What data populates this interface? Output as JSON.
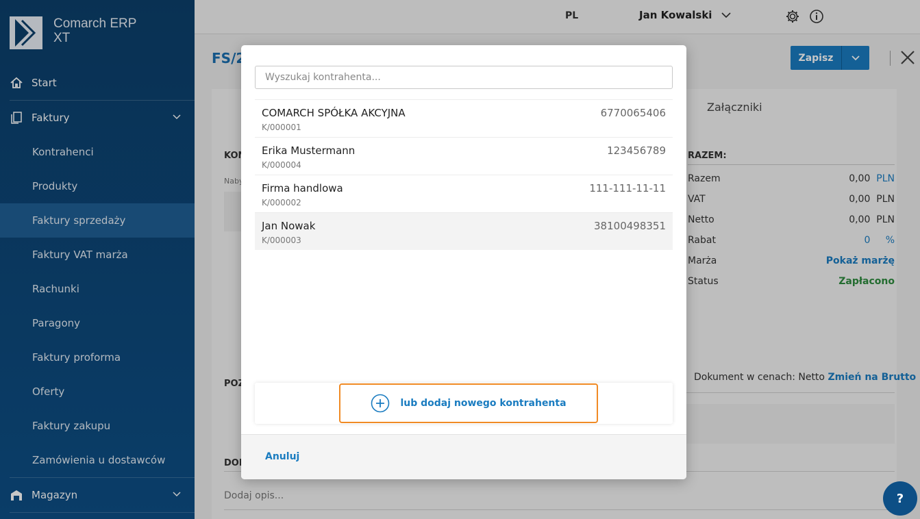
{
  "app": {
    "name_line1": "Comarch ERP",
    "name_line2": "XT"
  },
  "sidebar": {
    "items": [
      {
        "label": "Start",
        "icon": "home-icon"
      },
      {
        "label": "Faktury",
        "icon": "documents-icon"
      },
      {
        "label": "Kontrahenci"
      },
      {
        "label": "Produkty"
      },
      {
        "label": "Faktury sprzedaży"
      },
      {
        "label": "Faktury VAT marża"
      },
      {
        "label": "Rachunki"
      },
      {
        "label": "Paragony"
      },
      {
        "label": "Faktury proforma"
      },
      {
        "label": "Oferty"
      },
      {
        "label": "Faktury zakupu"
      },
      {
        "label": "Zamówienia u dostawców"
      },
      {
        "label": "Magazyn",
        "icon": "warehouse-icon"
      }
    ],
    "active_index": 4
  },
  "topbar": {
    "language": "PL",
    "user": "Jan Kowalski"
  },
  "page": {
    "title": "FS/2",
    "save_label": "Zapisz"
  },
  "background": {
    "tab_attachments": "Załączniki",
    "label_kon": "KON",
    "label_naby": "Naby",
    "label_poz": "POZ",
    "label_dod": "DOD",
    "summary_title": "RAZEM:",
    "summary": [
      {
        "label": "Razem",
        "value": "0,00",
        "currency": "PLN"
      },
      {
        "label": "VAT",
        "value": "0,00",
        "currency": "PLN"
      },
      {
        "label": "Netto",
        "value": "0,00",
        "currency": "PLN"
      },
      {
        "label": "Rabat",
        "value": "0",
        "currency": "%"
      },
      {
        "label": "Marża",
        "value": "Pokaż marżę"
      },
      {
        "label": "Status",
        "value": "Zapłacono"
      }
    ],
    "doc_prices_text": "Dokument w cenach: Netto",
    "doc_prices_link": "Zmień na Brutto",
    "description_placeholder": "Dodaj opis...",
    "help_label": "?"
  },
  "modal": {
    "search_placeholder": "Wyszukaj kontrahenta...",
    "contractors": [
      {
        "name": "COMARCH SPÓŁKA AKCYJNA",
        "code": "K/000001",
        "nip": "6770065406"
      },
      {
        "name": "Erika Mustermann",
        "code": "K/000004",
        "nip": "123456789"
      },
      {
        "name": "Firma handlowa",
        "code": "K/000002",
        "nip": "111-111-11-11"
      },
      {
        "name": "Jan Nowak",
        "code": "K/000003",
        "nip": "38100498351"
      }
    ],
    "add_label": "lub dodaj nowego kontrahenta",
    "cancel_label": "Anuluj"
  },
  "colors": {
    "sidebar": "#0c3f6b",
    "accent": "#1a7cc0",
    "highlight": "#f08a24",
    "status_paid": "#2e8b3e"
  }
}
